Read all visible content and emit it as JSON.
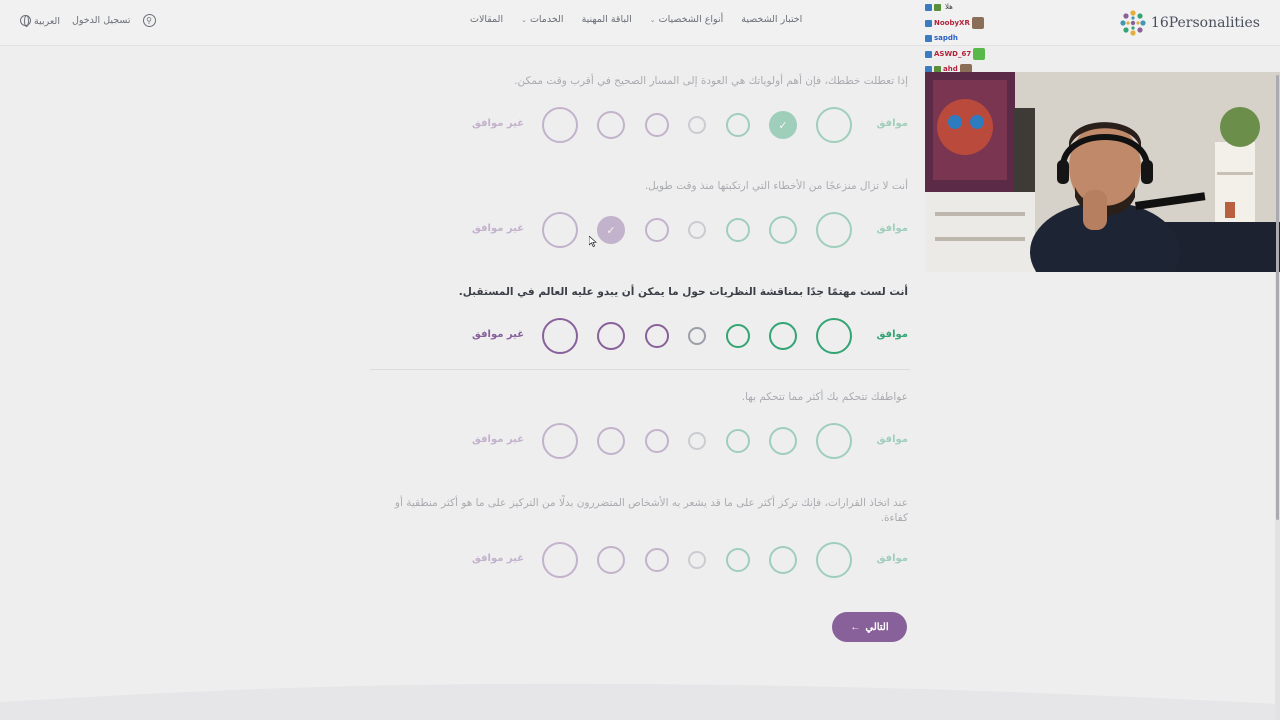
{
  "header": {
    "brand": "16Personalities",
    "nav": [
      {
        "label": "اختبار الشخصية",
        "dropdown": false
      },
      {
        "label": "أنواع الشخصيات",
        "dropdown": true
      },
      {
        "label": "الباقة المهنية",
        "dropdown": false
      },
      {
        "label": "الخدمات",
        "dropdown": true
      },
      {
        "label": "المقالات",
        "dropdown": false
      }
    ],
    "login": "تسجيل الدخول",
    "language": "العربية"
  },
  "scale": {
    "agree": "موافق",
    "disagree": "غير موافق"
  },
  "questions": [
    {
      "text": "إذا تعطلت خططك، فإن أهم أولوياتك هي العودة إلى المسار الصحيح في أقرب وقت ممكن.",
      "answered": true,
      "selected": 2,
      "state": "answered"
    },
    {
      "text": "أنت لا تزال منزعجًا من الأخطاء التي ارتكبتها منذ وقت طويل.",
      "answered": true,
      "selected": 6,
      "state": "answered"
    },
    {
      "text": "أنت لست مهتمًا جدًا بمناقشة النظريات حول ما يمكن أن يبدو عليه العالم في المستقبل.",
      "answered": false,
      "selected": null,
      "state": "active"
    },
    {
      "text": "عواطفك تتحكم بك أكثر مما تتحكم بها.",
      "answered": false,
      "selected": null,
      "state": "upcoming"
    },
    {
      "text": "عند اتخاذ القرارات، فإنك تركز أكثر على ما قد يشعر به الأشخاص المتضررون بدلًا من التركيز على ما هو أكثر منطقية أو كفاءة.",
      "answered": false,
      "selected": null,
      "state": "upcoming"
    }
  ],
  "next_button": "التالي",
  "colors": {
    "agree": "#33a474",
    "disagree": "#88619a",
    "neutral": "#9b9faa",
    "background": "#eeeeef"
  },
  "icons": {
    "check": "check-icon",
    "next": "arrow-left-icon",
    "language": "globe-icon",
    "accessibility": "accessibility-icon"
  },
  "chat": [
    {
      "user": "",
      "message": "هلا"
    },
    {
      "user": "NoobyXR",
      "message": ""
    },
    {
      "user": "sapdh",
      "message": ""
    },
    {
      "user": "ASWD_67",
      "message": ""
    },
    {
      "user": "ahd",
      "message": ""
    }
  ]
}
